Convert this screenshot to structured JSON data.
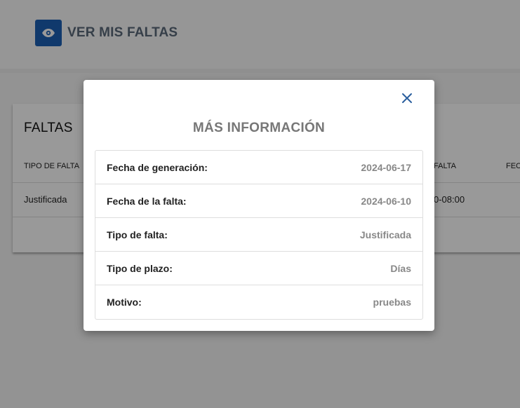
{
  "header": {
    "title": "VER MIS FALTAS",
    "icon": "eye-icon",
    "icon_bg": "#1c5fb5"
  },
  "card": {
    "title": "FALTAS",
    "columns": [
      "TIPO DE FALTA",
      "FALTA",
      "FEC"
    ],
    "rows": [
      {
        "tipo": "Justificada",
        "falta": "0-08:00"
      }
    ]
  },
  "modal": {
    "title": "MÁS INFORMACIÓN",
    "close_icon": "close-icon",
    "close_color": "#2b5f9e",
    "items": [
      {
        "label": "Fecha de generación:",
        "value": "2024-06-17"
      },
      {
        "label": "Fecha de la falta:",
        "value": "2024-06-10"
      },
      {
        "label": "Tipo de falta:",
        "value": "Justificada"
      },
      {
        "label": "Tipo de plazo:",
        "value": "Días"
      },
      {
        "label": "Motivo:",
        "value": "pruebas"
      }
    ]
  }
}
